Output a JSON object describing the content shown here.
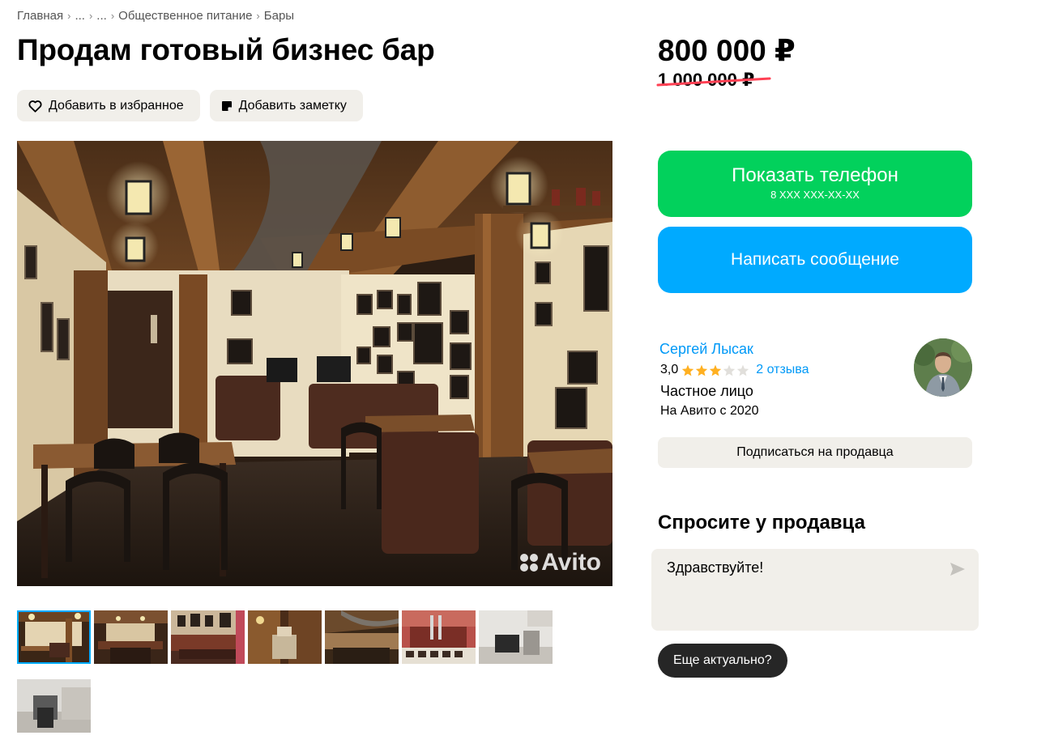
{
  "breadcrumb": {
    "items": [
      "Главная",
      "...",
      "...",
      "Общественное питание",
      "Бары"
    ],
    "separator": "›"
  },
  "listing": {
    "title": "Продам готовый бизнес бар",
    "favorite_label": "Добавить в избранное",
    "note_label": "Добавить заметку",
    "price": "800 000 ₽",
    "old_price": "1 000 000 ₽"
  },
  "gallery": {
    "watermark": "Avito",
    "thumbnail_count": 8,
    "active_index": 0
  },
  "contact": {
    "show_phone_label": "Показать телефон",
    "phone_masked": "8 XXX XXX-XX-XX",
    "message_label": "Написать сообщение"
  },
  "seller": {
    "name": "Сергей Лысак",
    "rating": "3,0",
    "rating_value": 3,
    "rating_max": 5,
    "reviews_label": "2 отзыва",
    "type": "Частное лицо",
    "since": "На Авито с 2020",
    "subscribe_label": "Подписаться на продавца"
  },
  "ask": {
    "title": "Спросите у продавца",
    "message_value": "Здравствуйте!",
    "quick_reply": "Еще актуально?"
  },
  "colors": {
    "green": "#02d15c",
    "blue": "#00aaff",
    "link": "#0099f7",
    "light_bg": "#f1efea",
    "star": "#ffb021",
    "strike": "#ff4053"
  },
  "icons": {
    "favorite": "heart-icon",
    "note": "note-icon",
    "send": "send-icon",
    "star": "star-icon"
  }
}
